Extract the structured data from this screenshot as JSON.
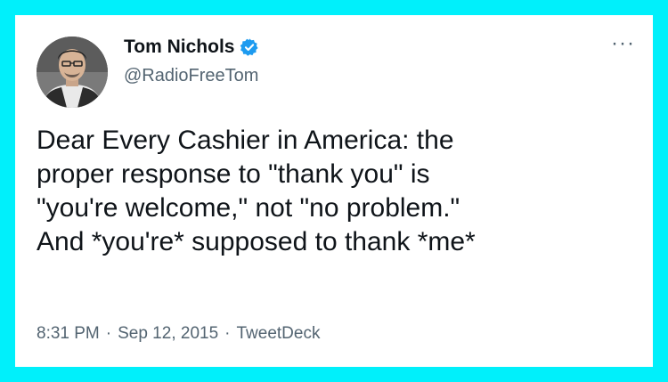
{
  "tweet": {
    "author": {
      "display_name": "Tom Nichols",
      "handle": "@RadioFreeTom",
      "verified": true,
      "avatar_icon": "profile-photo"
    },
    "more_label": "···",
    "text": "Dear Every Cashier in America: the\nproper response to \"thank you\" is\n\"you're welcome,\" not \"no problem.\"\nAnd *you're* supposed to thank *me*",
    "meta": {
      "time": "8:31 PM",
      "separator": "·",
      "date": "Sep 12, 2015",
      "source": "TweetDeck"
    }
  },
  "colors": {
    "frame": "#00f0fb",
    "card": "#ffffff",
    "primary_text": "#0f1419",
    "secondary_text": "#536471",
    "verified_badge": "#1d9bf0"
  }
}
